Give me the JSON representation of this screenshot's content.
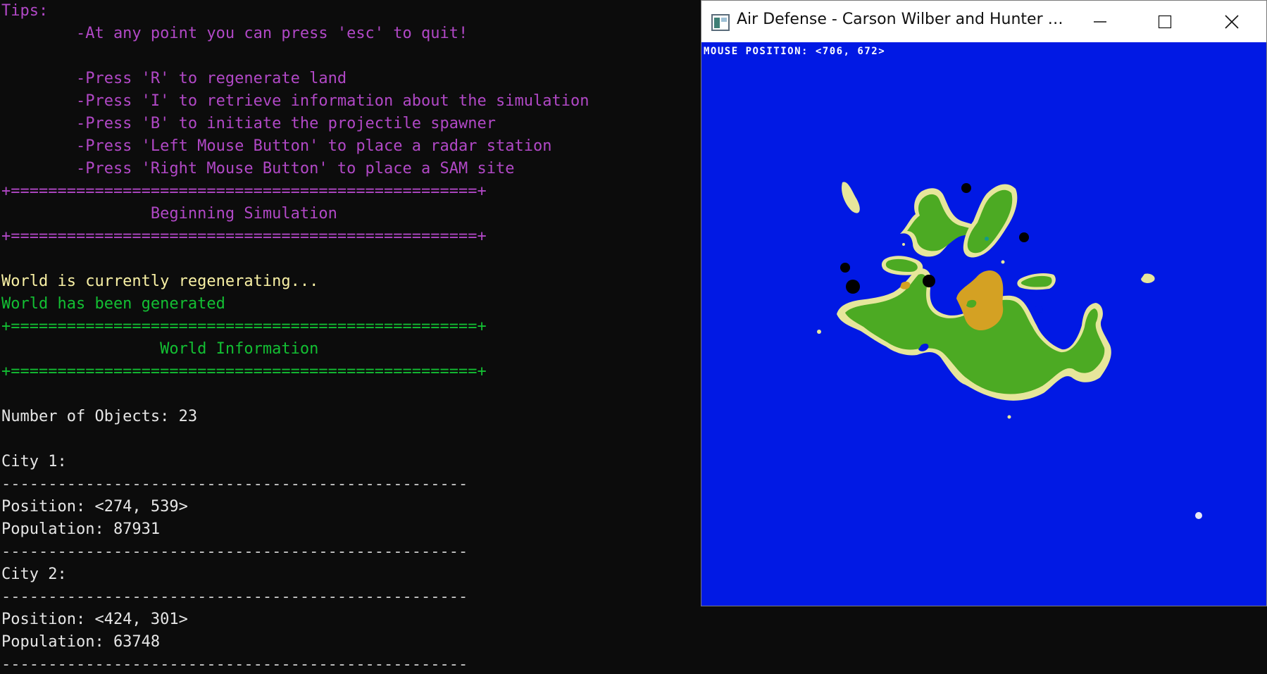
{
  "console": {
    "lines": [
      {
        "text": "Tips:",
        "color": "magenta"
      },
      {
        "text": "        -At any point you can press 'esc' to quit!",
        "color": "magenta"
      },
      {
        "text": "",
        "color": "magenta"
      },
      {
        "text": "        -Press 'R' to regenerate land",
        "color": "magenta"
      },
      {
        "text": "        -Press 'I' to retrieve information about the simulation",
        "color": "magenta"
      },
      {
        "text": "        -Press 'B' to initiate the projectile spawner",
        "color": "magenta"
      },
      {
        "text": "        -Press 'Left Mouse Button' to place a radar station",
        "color": "magenta"
      },
      {
        "text": "        -Press 'Right Mouse Button' to place a SAM site",
        "color": "magenta"
      },
      {
        "text": "+==================================================+",
        "color": "magenta"
      },
      {
        "text": "                Beginning Simulation",
        "color": "magenta"
      },
      {
        "text": "+==================================================+",
        "color": "magenta"
      },
      {
        "text": "",
        "color": "magenta"
      },
      {
        "text": "World is currently regenerating...",
        "color": "yellow"
      },
      {
        "text": "World has been generated",
        "color": "green"
      },
      {
        "text": "+==================================================+",
        "color": "green"
      },
      {
        "text": "                 World Information",
        "color": "green"
      },
      {
        "text": "+==================================================+",
        "color": "green"
      },
      {
        "text": "",
        "color": "white"
      },
      {
        "text": "Number of Objects: 23",
        "color": "white"
      },
      {
        "text": "",
        "color": "white"
      },
      {
        "text": "City 1:",
        "color": "white"
      },
      {
        "text": "--------------------------------------------------",
        "color": "sep"
      },
      {
        "text": "Position: <274, 539>",
        "color": "white"
      },
      {
        "text": "Population: 87931",
        "color": "white"
      },
      {
        "text": "--------------------------------------------------",
        "color": "sep"
      },
      {
        "text": "City 2:",
        "color": "white"
      },
      {
        "text": "--------------------------------------------------",
        "color": "sep"
      },
      {
        "text": "Position: <424, 301>",
        "color": "white"
      },
      {
        "text": "Population: 63748",
        "color": "white"
      },
      {
        "text": "--------------------------------------------------",
        "color": "sep"
      }
    ],
    "colors": {
      "magenta": "#b148c6",
      "yellow": "#f9f1a5",
      "green": "#13bf33",
      "white": "#e6e6e6",
      "sep": "#cccccc"
    }
  },
  "window": {
    "title": "Air Defense - Carson Wilber and Hunter W...",
    "app_icon": "window-app-icon",
    "controls": [
      "minimize-icon",
      "maximize-icon",
      "close-icon"
    ],
    "mouse_position_label": "MOUSE POSITION: <706, 672>",
    "map_colors": {
      "water": "#0119e4",
      "beach": "#e6e69b",
      "grass": "#4caa23",
      "desert": "#d4a123",
      "city": "#000000"
    }
  }
}
